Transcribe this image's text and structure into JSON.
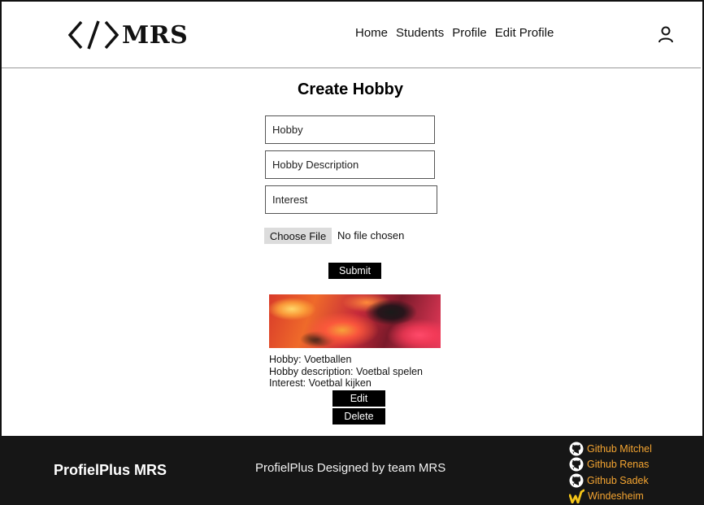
{
  "header": {
    "logo_text": "MRS",
    "nav": [
      "Home",
      "Students",
      "Profile",
      "Edit Profile"
    ]
  },
  "form": {
    "title": "Create Hobby",
    "hobby_placeholder": "Hobby",
    "description_placeholder": "Hobby Description",
    "interest_placeholder": "Interest",
    "file_button": "Choose File",
    "file_status": "No file chosen",
    "submit_label": "Submit"
  },
  "hobby_card": {
    "hobby": "Hobby: Voetballen",
    "description": "Hobby description: Voetbal spelen",
    "interest": "Interest: Voetbal kijken",
    "edit_label": "Edit",
    "delete_label": "Delete"
  },
  "footer": {
    "brand": "ProfielPlus MRS",
    "credit": "ProfielPlus Designed by team MRS",
    "links": [
      {
        "label": "Github Mitchel",
        "icon": "github-icon"
      },
      {
        "label": "Github Renas",
        "icon": "github-icon"
      },
      {
        "label": "Github Sadek",
        "icon": "github-icon"
      },
      {
        "label": "Windesheim",
        "icon": "windesheim-icon"
      }
    ],
    "link_color": "#f5a531"
  }
}
